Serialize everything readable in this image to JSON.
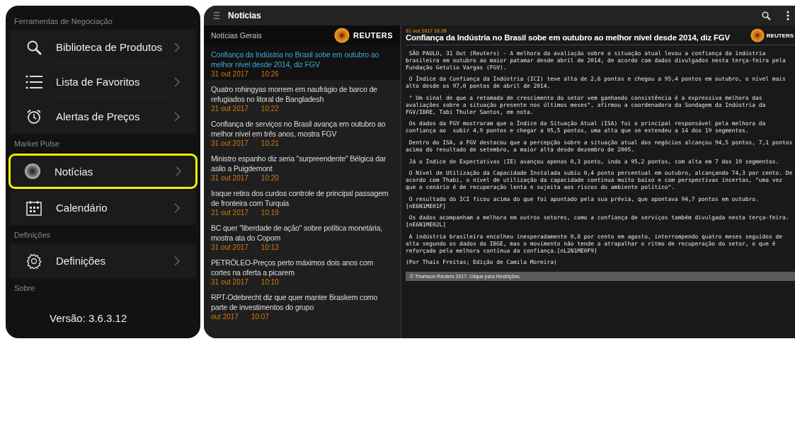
{
  "menu": {
    "sections": [
      {
        "header": "Ferramentas de Negociação",
        "items": [
          {
            "label": "Biblioteca de Produtos",
            "kind": "search",
            "selected": false
          },
          {
            "label": "Lista de Favoritos",
            "kind": "list",
            "selected": false
          },
          {
            "label": "Alertas de Preços",
            "kind": "alarm",
            "selected": false
          }
        ]
      },
      {
        "header": "Market Pulse",
        "items": [
          {
            "label": "Notícias",
            "kind": "swirl",
            "selected": true
          },
          {
            "label": "Calendário",
            "kind": "calendar",
            "selected": false
          }
        ]
      },
      {
        "header": "Definições",
        "items": [
          {
            "label": "Definições",
            "kind": "gear",
            "selected": false
          }
        ]
      },
      {
        "header": "Sobre"
      }
    ],
    "version": "Versão: 3.6.3.12"
  },
  "news_app": {
    "title": "Notícias",
    "list_header": "Notícias Gerais",
    "brand": "REUTERS",
    "items": [
      {
        "headline": "Confiança da Indústria no Brasil sobe em outubro ao melhor nível desde 2014, diz FGV",
        "date": "31 out 2017",
        "time": "10:26",
        "selected": true
      },
      {
        "headline": "Quatro rohingyas morrem em naufrágio de barco de refugiados no litoral de Bangladesh",
        "date": "31 out 2017",
        "time": "10:22",
        "selected": false
      },
      {
        "headline": "Confiança de serviços no Brasil avança em outubro ao melhor nível em três anos, mostra FGV",
        "date": "31 out 2017",
        "time": "10:21",
        "selected": false
      },
      {
        "headline": "Ministro espanho diz seria \"surpreendente\" Bélgica dar asilo a Puigdemont",
        "date": "31 out 2017",
        "time": "10:20",
        "selected": false
      },
      {
        "headline": "Iraque retira dos curdos controle de principal passagem de fronteira com Turquia",
        "date": "31 out 2017",
        "time": "10:19",
        "selected": false
      },
      {
        "headline": "BC quer \"liberdade de ação\" sobre política monetária, mostra ata do Copom",
        "date": "31 out 2017",
        "time": "10:13",
        "selected": false
      },
      {
        "headline": "PETRÓLEO-Preços perto máximos dois anos com cortes na oferta a picarem",
        "date": "31 out 2017",
        "time": "10:10",
        "selected": false
      },
      {
        "headline": "RPT-Odebrecht diz que quer manter Braskem como parte de investimentos do grupo",
        "date": "out 2017",
        "time": "10:07",
        "selected": false
      }
    ],
    "article": {
      "timestamp": "31 out 2017 10:26",
      "headline": "Confiança da Indústria no Brasil sobe em outubro ao melhor nível desde 2014, diz FGV",
      "brand": "REUTERS",
      "paragraphs": [
        " SÃO PAULO, 31 Out (Reuters) - A melhora da avaliação sobre a situação atual levou a confiança da indústria brasileira em outubro ao maior patamar desde abril de 2014, de acordo com dados divulgados nesta terça-feira pela Fundação Getulio Vargas (FGV).",
        " O Índice da Confiança da Indústria (ICI) teve alta de 2,6 pontos e chegou a 95,4 pontos em outubro, o nível mais alto desde os 97,0 pontos de abril de 2014.",
        " \" Um sinal de que a retomada de crescimento do setor vem ganhando consistência é a expressiva melhora das avaliações sobre a situação presente nos últimos meses\", afirmou a coordenadora da Sondagem da Indústria da FGV/IBRE, Tabi Thuler Santos, em nota.",
        " Os dados da FGV mostraram que o Índice da Situação Atual (ISA) foi o principal responsável pela melhora da confiança ao  subir 4,9 pontos e chegar a 95,5 pontos, uma alta que se estendeu a 14 dos 19 segmentos.",
        " Dentro do ISA, a FGV destacou que a percepção sobre a situação atual dos negócios alcançou 94,5 pontos, 7,1 pontos acima do resultado de setembro, a maior alta desde dezembro de 2005.",
        " Já o Índice de Expectativas (IE) avançou apenas 0,3 ponto, indo a 95,2 pontos, com alta em 7 dos 19 segmentos.",
        " O Nível de Utilização da Capacidade Instalada subiu 0,4 ponto percentual em outubro, alcançando 74,3 por cento. De acordo com Thabi, o nível de utilização da capacidade continua muito baixo e com perspectivas incertas, \"uma vez que o cenário é de recuperação lenta e sujeita aos riscos do ambiente político\".",
        " O resultado do ICI ficou acima do que foi apontado pela sua prévia, que apontava 94,7 pontos em outubro.[nE6N1ME01F]",
        " Os dados acompanham a melhora em outros setores, como a confiança de serviços também divulgada nesta terça-feira. [nE6N1ME02L]",
        " A indústria brasileira encolheu inesperadamente 0,8 por cento em agosto, interrompendo quatro meses seguidos de alta segundo os dados do IBGE, mas o movimento não tende a atrapalhar o ritmo de recuperação do setor, o que é reforçado pela melhora contínua da confiança.[nL2N1ME0F9]",
        "(Por Thais Freitas; Edição de Camila Moreira)"
      ],
      "footer": "© Thomson Reuters 2017. Clique para Restrições."
    }
  }
}
